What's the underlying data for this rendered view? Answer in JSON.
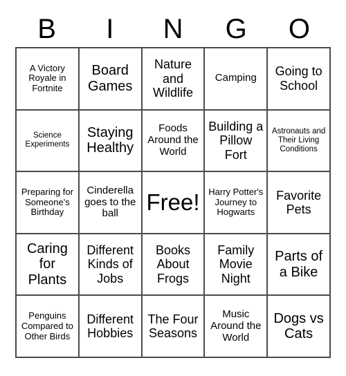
{
  "card": {
    "title": "BINGO Card",
    "header_letters": [
      "B",
      "I",
      "N",
      "G",
      "O"
    ],
    "grid": {
      "rows": 5,
      "columns": 5,
      "border_color": "#4a4a4a",
      "background_color": "#ffffff",
      "text_color": "#000000"
    },
    "cells": [
      {
        "text": "A Victory Royale in Fortnite",
        "size": "s",
        "free": false
      },
      {
        "text": "Board Games",
        "size": "xl",
        "free": false
      },
      {
        "text": "Nature and Wildlife",
        "size": "l",
        "free": false
      },
      {
        "text": "Camping",
        "size": "m",
        "free": false
      },
      {
        "text": "Going to School",
        "size": "l",
        "free": false
      },
      {
        "text": "Science Experiments",
        "size": "xs",
        "free": false
      },
      {
        "text": "Staying Healthy",
        "size": "xl",
        "free": false
      },
      {
        "text": "Foods Around the World",
        "size": "m",
        "free": false
      },
      {
        "text": "Building a Pillow Fort",
        "size": "l",
        "free": false
      },
      {
        "text": "Astronauts and Their Living Conditions",
        "size": "xs",
        "free": false
      },
      {
        "text": "Preparing for Someone's Birthday",
        "size": "s",
        "free": false
      },
      {
        "text": "Cinderella goes to the ball",
        "size": "m",
        "free": false
      },
      {
        "text": "Free!",
        "size": "free",
        "free": true
      },
      {
        "text": "Harry Potter's Journey to Hogwarts",
        "size": "s",
        "free": false
      },
      {
        "text": "Favorite Pets",
        "size": "l",
        "free": false
      },
      {
        "text": "Caring for Plants",
        "size": "xl",
        "free": false
      },
      {
        "text": "Different Kinds of Jobs",
        "size": "l",
        "free": false
      },
      {
        "text": "Books About Frogs",
        "size": "l",
        "free": false
      },
      {
        "text": "Family Movie Night",
        "size": "l",
        "free": false
      },
      {
        "text": "Parts of a Bike",
        "size": "xl",
        "free": false
      },
      {
        "text": "Penguins Compared to Other Birds",
        "size": "s",
        "free": false
      },
      {
        "text": "Different Hobbies",
        "size": "l",
        "free": false
      },
      {
        "text": "The Four Seasons",
        "size": "l",
        "free": false
      },
      {
        "text": "Music Around the World",
        "size": "m",
        "free": false
      },
      {
        "text": "Dogs vs Cats",
        "size": "xl",
        "free": false
      }
    ]
  }
}
